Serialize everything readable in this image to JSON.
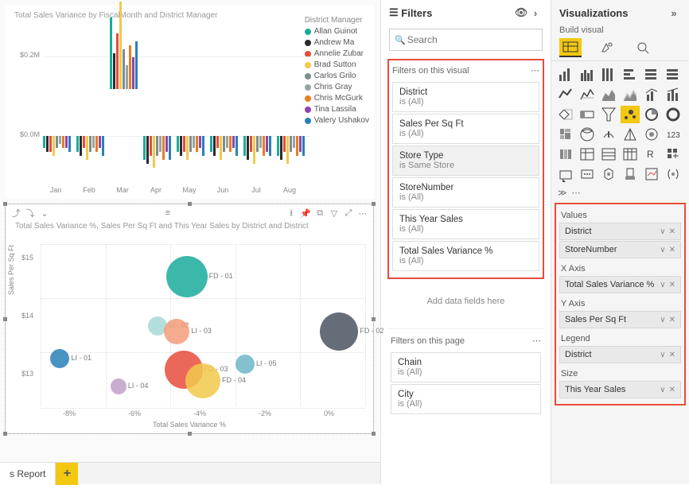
{
  "tabs": {
    "report": "s Report"
  },
  "chart_top": {
    "title": "Total Sales Variance by FiscalMonth and District Manager",
    "legend_title": "District Manager",
    "yticks": [
      "$0.2M",
      "$0.0M"
    ],
    "legend": [
      {
        "name": "Allan Guinot",
        "color": "#1aab9b"
      },
      {
        "name": "Andrew Ma",
        "color": "#2b2b2b"
      },
      {
        "name": "Annelie Zubar",
        "color": "#e74c3c"
      },
      {
        "name": "Brad Sutton",
        "color": "#f2c94c"
      },
      {
        "name": "Carlos Grilo",
        "color": "#7f8c8d"
      },
      {
        "name": "Chris Gray",
        "color": "#95a5a6"
      },
      {
        "name": "Chris McGurk",
        "color": "#e67e22"
      },
      {
        "name": "Tina Lassila",
        "color": "#8e44ad"
      },
      {
        "name": "Valery Ushakov",
        "color": "#2980b9"
      }
    ]
  },
  "chart_data": [
    {
      "type": "bar",
      "title": "Total Sales Variance by FiscalMonth and District Manager",
      "ylabel": "",
      "xlabel": "",
      "ylim": [
        -0.15,
        0.25
      ],
      "categories": [
        "Jan",
        "Feb",
        "Mar",
        "Apr",
        "May",
        "Jun",
        "Jul",
        "Aug"
      ],
      "series": [
        {
          "name": "Allan Guinot",
          "color": "#1aab9b",
          "values": [
            -0.03,
            -0.04,
            0.18,
            -0.06,
            -0.04,
            -0.04,
            -0.05,
            -0.05
          ]
        },
        {
          "name": "Andrew Ma",
          "color": "#2b2b2b",
          "values": [
            -0.04,
            -0.05,
            0.09,
            -0.07,
            -0.05,
            -0.05,
            -0.06,
            -0.06
          ]
        },
        {
          "name": "Annelie Zubar",
          "color": "#e74c3c",
          "values": [
            -0.04,
            -0.03,
            0.14,
            -0.05,
            -0.04,
            -0.03,
            -0.04,
            -0.04
          ]
        },
        {
          "name": "Brad Sutton",
          "color": "#f2c94c",
          "values": [
            -0.05,
            -0.06,
            0.22,
            -0.08,
            -0.06,
            -0.06,
            -0.07,
            -0.07
          ]
        },
        {
          "name": "Carlos Grilo",
          "color": "#7f8c8d",
          "values": [
            -0.03,
            -0.04,
            0.1,
            -0.05,
            -0.04,
            -0.04,
            -0.04,
            -0.04
          ]
        },
        {
          "name": "Chris Gray",
          "color": "#95a5a6",
          "values": [
            -0.02,
            -0.03,
            0.06,
            -0.04,
            -0.03,
            -0.03,
            -0.03,
            -0.03
          ]
        },
        {
          "name": "Chris McGurk",
          "color": "#e67e22",
          "values": [
            -0.03,
            -0.04,
            0.11,
            -0.06,
            -0.04,
            -0.04,
            -0.05,
            -0.05
          ]
        },
        {
          "name": "Tina Lassila",
          "color": "#8e44ad",
          "values": [
            -0.03,
            -0.03,
            0.08,
            -0.04,
            -0.03,
            -0.03,
            -0.04,
            -0.04
          ]
        },
        {
          "name": "Valery Ushakov",
          "color": "#2980b9",
          "values": [
            -0.04,
            -0.05,
            0.12,
            -0.06,
            -0.05,
            -0.05,
            -0.05,
            -0.05
          ]
        }
      ]
    },
    {
      "type": "scatter",
      "title": "Total Sales Variance %, Sales Per Sq Ft and This Year Sales by District and District",
      "xlabel": "Total Sales Variance %",
      "ylabel": "Sales Per Sq Ft",
      "xlim": [
        -9,
        1
      ],
      "ylim": [
        12.5,
        15.5
      ],
      "xticks": [
        "-8%",
        "-6%",
        "-4%",
        "-2%",
        "0%"
      ],
      "yticks": [
        "$13",
        "$14",
        "$15"
      ],
      "points": [
        {
          "label": "FD - 01",
          "x": -4.5,
          "y": 14.9,
          "r": 26,
          "color": "#1aab9b"
        },
        {
          "label": "FD - 02",
          "x": 0.2,
          "y": 13.9,
          "r": 24,
          "color": "#4a5560"
        },
        {
          "label": "LI - 01",
          "x": -8.4,
          "y": 13.4,
          "r": 12,
          "color": "#2980b9"
        },
        {
          "label": "LI - 02",
          "x": -5.4,
          "y": 14.0,
          "r": 12,
          "color": "#a5d8d6"
        },
        {
          "label": "FD - 03",
          "x": -4.6,
          "y": 13.2,
          "r": 24,
          "color": "#e74c3c"
        },
        {
          "label": "FD - 04",
          "x": -4.0,
          "y": 13.0,
          "r": 22,
          "color": "#f2c94c"
        },
        {
          "label": "LI - 03",
          "x": -4.8,
          "y": 13.9,
          "r": 16,
          "color": "#f39c7a"
        },
        {
          "label": "LI - 04",
          "x": -6.6,
          "y": 12.9,
          "r": 10,
          "color": "#bfa0c8"
        },
        {
          "label": "LI - 05",
          "x": -2.7,
          "y": 13.3,
          "r": 12,
          "color": "#6fb6c6"
        }
      ]
    }
  ],
  "filters": {
    "title": "Filters",
    "search_placeholder": "Search",
    "visual_header": "Filters on this visual",
    "visual": [
      {
        "t": "District",
        "v": "is (All)"
      },
      {
        "t": "Sales Per Sq Ft",
        "v": "is (All)"
      },
      {
        "t": "Store Type",
        "v": "is Same Store",
        "sel": true
      },
      {
        "t": "StoreNumber",
        "v": "is (All)"
      },
      {
        "t": "This Year Sales",
        "v": "is (All)"
      },
      {
        "t": "Total Sales Variance %",
        "v": "is (All)"
      }
    ],
    "add_hint": "Add data fields here",
    "page_header": "Filters on this page",
    "page": [
      {
        "t": "Chain",
        "v": "is (All)"
      },
      {
        "t": "City",
        "v": "is (All)"
      }
    ]
  },
  "viz": {
    "title": "Visualizations",
    "build": "Build visual",
    "wells": {
      "values_h": "Values",
      "values": [
        "District",
        "StoreNumber"
      ],
      "x_h": "X Axis",
      "x": "Total Sales Variance %",
      "y_h": "Y Axis",
      "y": "Sales Per Sq Ft",
      "legend_h": "Legend",
      "legend": "District",
      "size_h": "Size",
      "size": "This Year Sales"
    }
  }
}
